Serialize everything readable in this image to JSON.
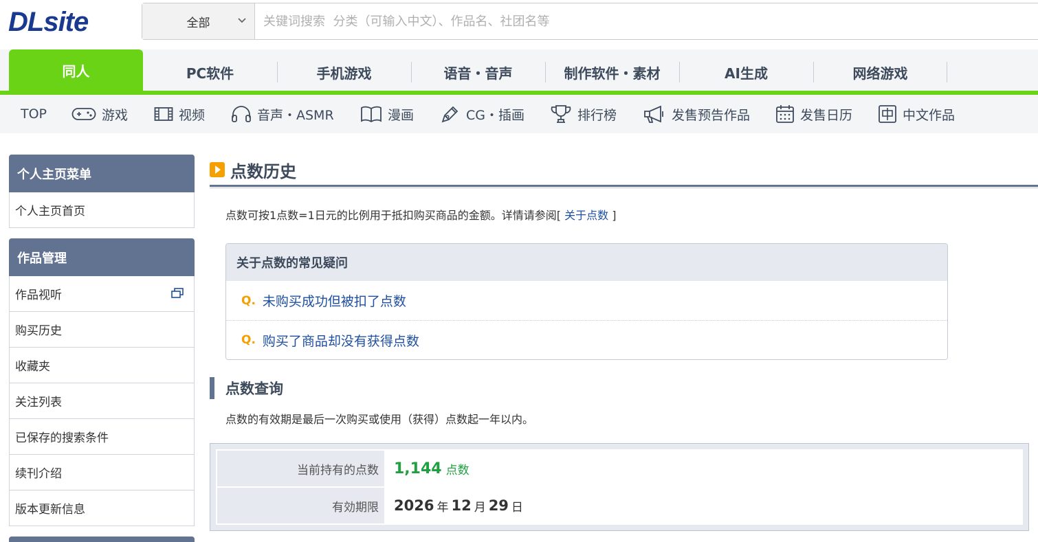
{
  "header": {
    "logo": "DLsite",
    "search_category": "全部",
    "search_placeholder": "关键词搜索  分类（可输入中文）、作品名、社团名等"
  },
  "main_tabs": [
    {
      "label": "同人",
      "active": true
    },
    {
      "label": "PC软件"
    },
    {
      "label": "手机游戏"
    },
    {
      "label": "语音・音声"
    },
    {
      "label": "制作软件・素材"
    },
    {
      "label": "AI生成"
    },
    {
      "label": "网络游戏"
    }
  ],
  "sub_nav": [
    {
      "label": "TOP",
      "icon": ""
    },
    {
      "label": "游戏",
      "icon": "gamepad-icon"
    },
    {
      "label": "视频",
      "icon": "film-icon"
    },
    {
      "label": "音声・ASMR",
      "icon": "headphones-icon"
    },
    {
      "label": "漫画",
      "icon": "book-icon"
    },
    {
      "label": "CG・插画",
      "icon": "pen-icon"
    },
    {
      "label": "排行榜",
      "icon": "trophy-icon"
    },
    {
      "label": "发售预告作品",
      "icon": "megaphone-icon"
    },
    {
      "label": "发售日历",
      "icon": "calendar-icon"
    },
    {
      "label": "中文作品",
      "icon": "chinese-char-icon"
    }
  ],
  "sidebar": {
    "menu1": {
      "title": "个人主页菜单",
      "items": [
        "个人主页首页"
      ]
    },
    "menu2": {
      "title": "作品管理",
      "items": [
        "作品视听",
        "购买历史",
        "收藏夹",
        "关注列表",
        "已保存的搜索条件",
        "续刊介绍",
        "版本更新信息"
      ]
    }
  },
  "content": {
    "title": "点数历史",
    "description_prefix": "点数可按1点数=1日元的比例用于抵扣购买商品的金额。详情请参阅[ ",
    "description_link": "关于点数",
    "description_suffix": " ]",
    "faq": {
      "title": "关于点数的常见疑问",
      "q_marker": "Q.",
      "items": [
        "未购买成功但被扣了点数",
        "购买了商品却没有获得点数"
      ]
    },
    "query": {
      "title": "点数查询",
      "description": "点数的有效期是最后一次购买或使用（获得）点数起一年以内。",
      "points_label": "当前持有的点数",
      "points_value": "1,144",
      "points_unit": "点数",
      "expiry_label": "有効期限",
      "expiry_year": "2026",
      "expiry_year_unit": "年",
      "expiry_month": "12",
      "expiry_month_unit": "月",
      "expiry_day": "29",
      "expiry_day_unit": "日"
    }
  },
  "colors": {
    "brand_green": "#6ad316",
    "nav_slate": "#627291",
    "link_blue": "#1f4fa0",
    "points_green": "#20a040",
    "accent_orange": "#f5a000"
  }
}
